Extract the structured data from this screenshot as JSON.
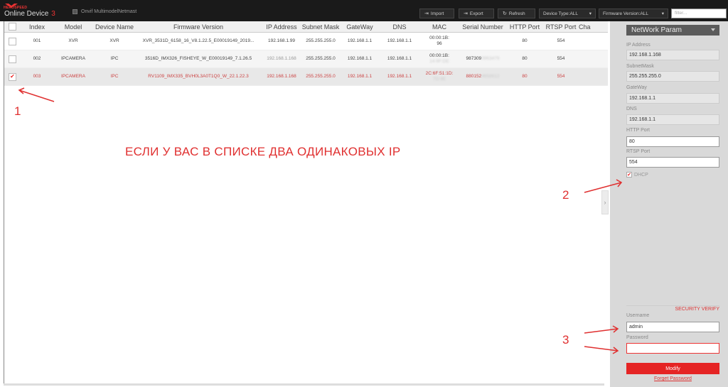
{
  "header": {
    "logo_text": "HEROSPEED",
    "online_label": "Online Device",
    "online_count": "3",
    "onvif_label": "Onvif MultimodelNetmast",
    "import_label": "Import",
    "export_label": "Export",
    "refresh_label": "Refresh",
    "device_type": "Device Type:ALL",
    "firmware_version": "Firmware Version:ALL",
    "filter_placeholder": "filter..."
  },
  "table": {
    "columns": [
      "Index",
      "Model",
      "Device Name",
      "Firmware Version",
      "IP Address",
      "Subnet Mask",
      "GateWay",
      "DNS",
      "MAC",
      "Serial Number",
      "HTTP Port",
      "RTSP Port",
      "Cha"
    ],
    "rows": [
      {
        "checked": false,
        "index": "001",
        "model": "XVR",
        "name": "XVR",
        "firmware": "XVR_3531D_6158_16_V8.1.22.5_E00019149_2019...",
        "ip": "192.168.1.99",
        "mask": "255.255.255.0",
        "gateway": "192.168.1.1",
        "dns": "192.168.1.1",
        "mac1": "00:00:1B:",
        "mac2": "96",
        "serial": "",
        "http": "80",
        "rtsp": "554"
      },
      {
        "checked": false,
        "index": "002",
        "model": "IPCAMERA",
        "name": "IPC",
        "firmware": "3516D_IMX326_FISHEYE_W_E00019149_7.1.26.5",
        "ip": "192.168.1.168",
        "mask": "255.255.255.0",
        "gateway": "192.168.1.1",
        "dns": "192.168.1.1",
        "mac1": "00:00:1B:",
        "mac2": "",
        "serial": "987309",
        "http": "80",
        "rtsp": "554"
      },
      {
        "checked": true,
        "index": "003",
        "model": "IPCAMERA",
        "name": "IPC",
        "firmware": "RV1109_IMX335_BVH0L3A0T1Q0_W_22.1.22.3",
        "ip": "192.168.1.168",
        "mask": "255.255.255.0",
        "gateway": "192.168.1.1",
        "dns": "192.168.1.1",
        "mac1": "2C:6F:51:1D:",
        "mac2": "",
        "serial": "880152",
        "http": "80",
        "rtsp": "554"
      }
    ]
  },
  "panel": {
    "dropdown": "NetWork Param",
    "ip_label": "IP Address",
    "ip_value": "192.168.1.168",
    "mask_label": "SubnetMask",
    "mask_value": "255.255.255.0",
    "gateway_label": "GateWay",
    "gateway_value": "192.168.1.1",
    "dns_label": "DNS",
    "dns_value": "192.168.1.1",
    "http_label": "HTTP Port",
    "http_value": "80",
    "rtsp_label": "RTSP Port",
    "rtsp_value": "554",
    "dhcp_label": "DHCP",
    "security_title": "SECURITY VERIFY",
    "username_label": "Username",
    "username_value": "admin",
    "password_label": "Password",
    "password_value": "",
    "modify_label": "Modify",
    "forget_label": "Forget Password"
  },
  "annotations": {
    "n1": "1",
    "n2": "2",
    "n3": "3",
    "message": "ЕСЛИ У ВАС В СПИСКЕ ДВА ОДИНАКОВЫХ IP"
  },
  "colors": {
    "accent": "#e52424",
    "annotation": "#e03030",
    "topbar": "#1a1a1a",
    "panel": "#d9d9d9"
  }
}
